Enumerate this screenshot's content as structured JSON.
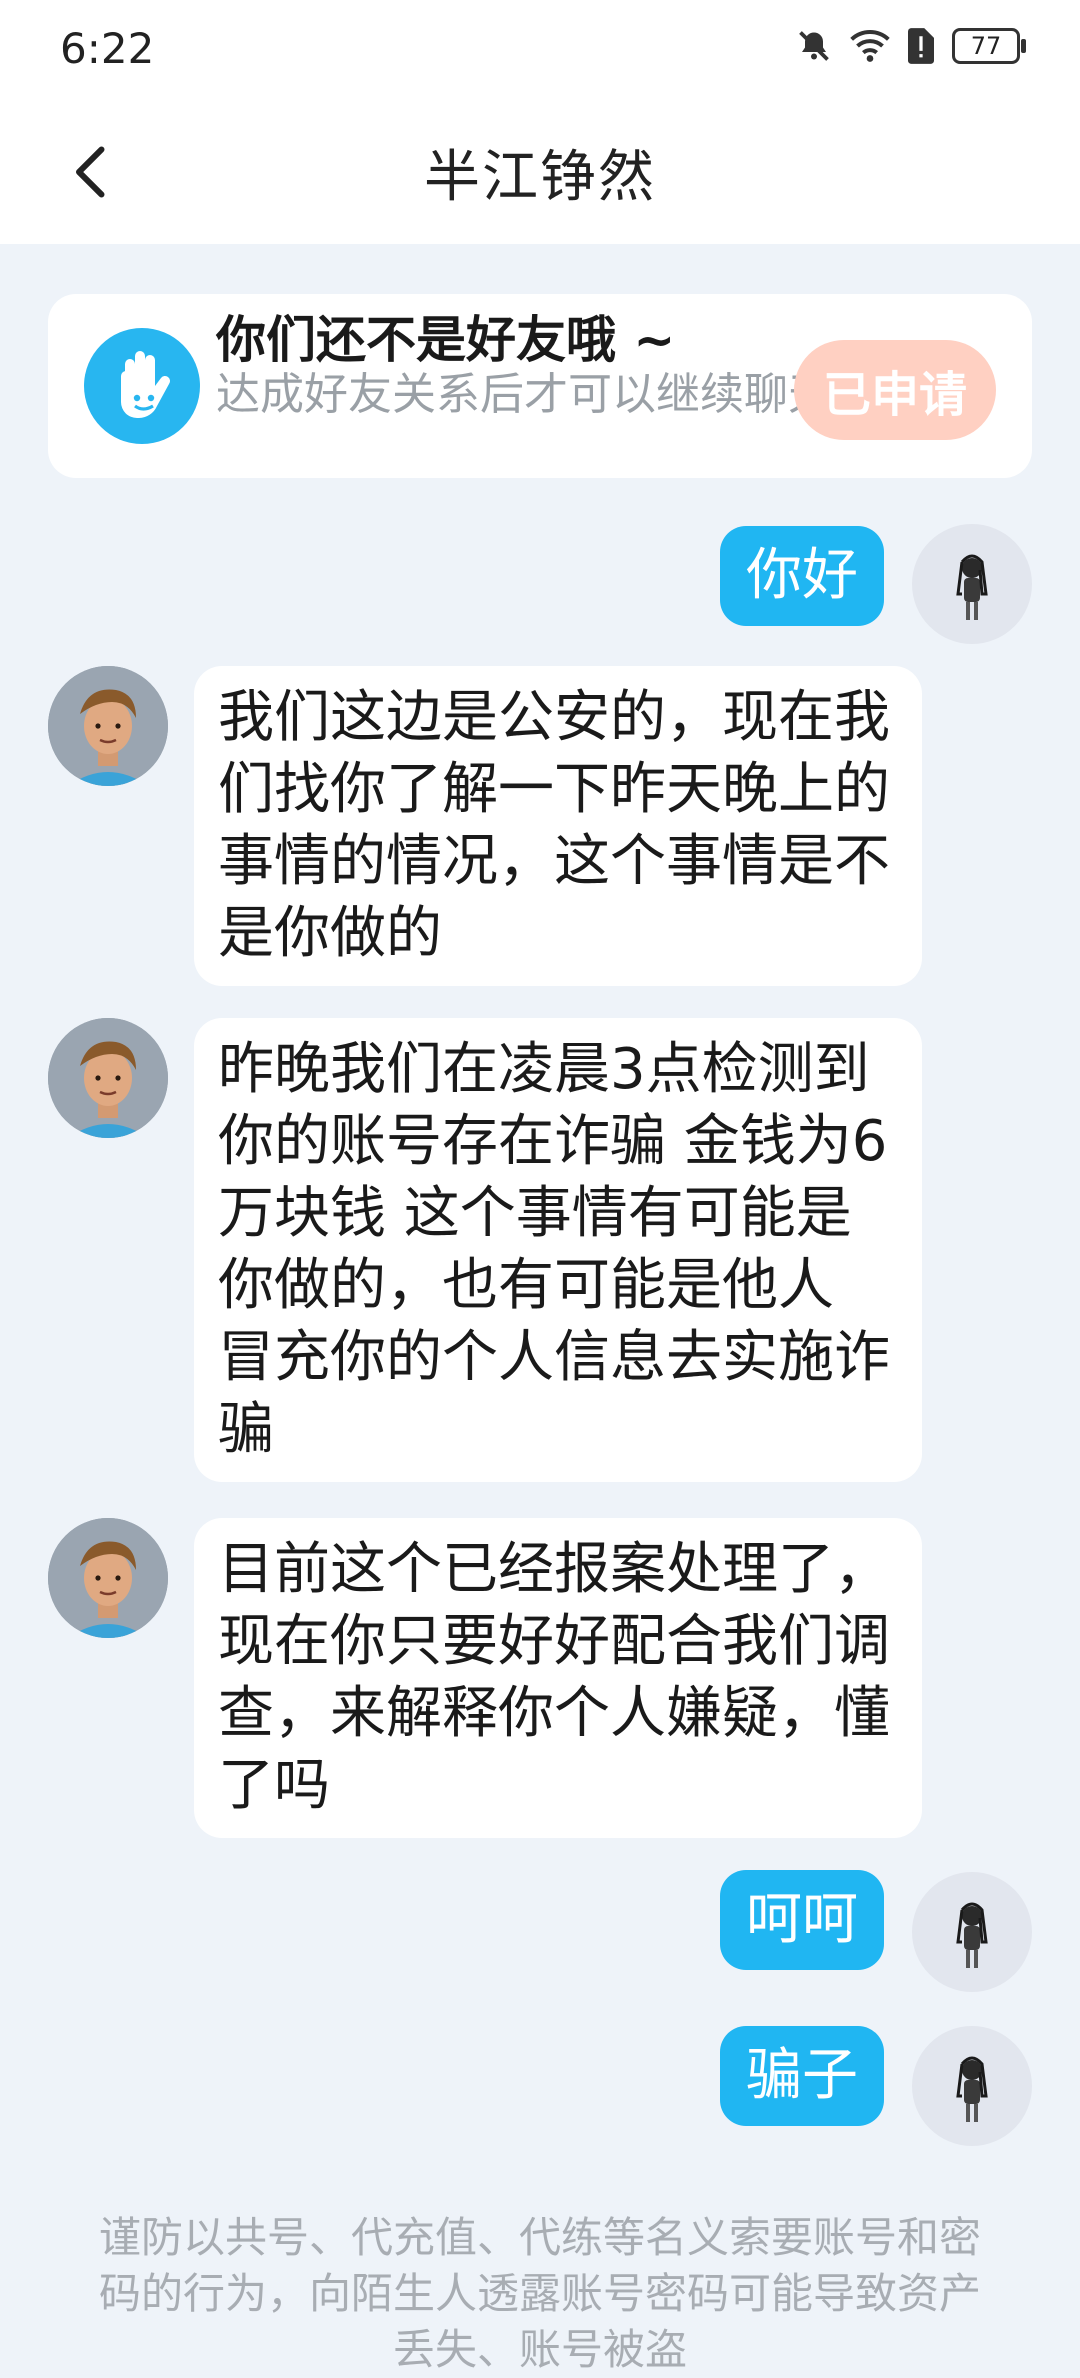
{
  "status_bar": {
    "time": "6:22",
    "battery": "77"
  },
  "header": {
    "title": "半江铮然"
  },
  "friend_notice": {
    "title": "你们还不是好友哦 ~",
    "description": "达成好友关系后才可以继续聊天",
    "button_label": "已申请",
    "button_color": "#ffd0c2"
  },
  "messages": [
    {
      "from": "me",
      "text": "你好"
    },
    {
      "from": "them",
      "text": "我们这边是公安的，现在我们找你了解一下昨天晚上的事情的情况，这个事情是不是你做的"
    },
    {
      "from": "them",
      "text": "昨晚我们在凌晨3点检测到你的账号存在诈骗 金钱为6万块钱 这个事情有可能是你做的，也有可能是他人 冒充你的个人信息去实施诈骗"
    },
    {
      "from": "them",
      "text": "目前这个已经报案处理了，现在你只要好好配合我们调查，来解释你个人嫌疑，懂了吗"
    },
    {
      "from": "me",
      "text": "呵呵"
    },
    {
      "from": "me",
      "text": "骗子"
    }
  ],
  "footer": {
    "warning": "谨防以共号、代充值、代练等名义索要账号和密码的行为，向陌生人透露账号密码可能导致资产丢失、账号被盗"
  },
  "colors": {
    "my_bubble": "#20b6f2",
    "their_bubble": "#ffffff",
    "background": "#eef3f9"
  }
}
